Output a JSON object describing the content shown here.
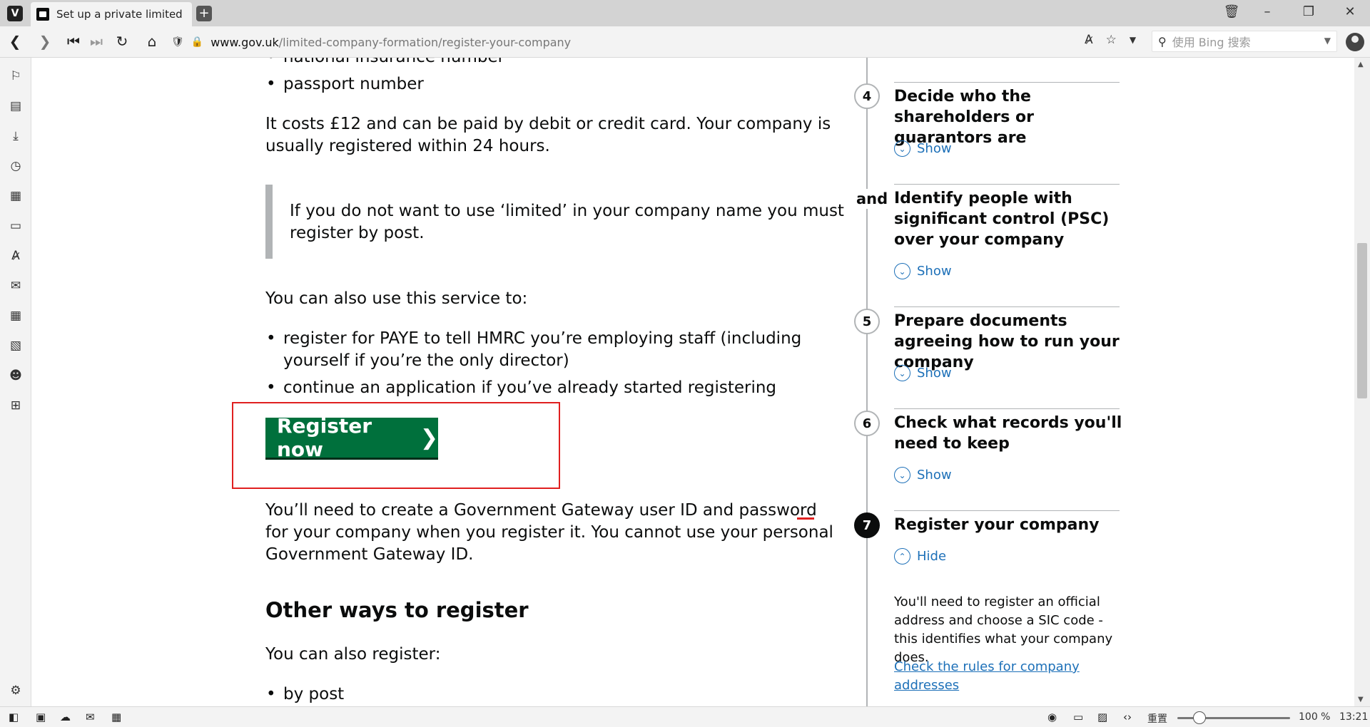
{
  "browser": {
    "logo": "V",
    "tab_title": "Set up a private limited company",
    "url_domain": "www.gov.uk",
    "url_path": "/limited-company-formation/register-your-company",
    "search_placeholder": "使用 Bing 搜索",
    "zoom_reset_label": "重置",
    "zoom_value": "100 %",
    "clock": "13:21"
  },
  "main": {
    "bullet_cut_top": "national insurance number",
    "bullet_passport": "passport number",
    "cost_text": "It costs £12 and can be paid by debit or credit card. Your company is usually registered within 24 hours.",
    "inset_text": "If you do not want to use ‘limited’ in your company name you must register by post.",
    "service_intro": "You can also use this service to:",
    "service_items": [
      "register for PAYE to tell HMRC you’re employing staff (including yourself if you’re the only director)",
      "continue an application if you’ve already started registering"
    ],
    "register_button": "Register now",
    "register_chevron": "❯",
    "gateway_text": "You’ll need to create a Government Gateway user ID and password for your company when you register it. You cannot use your personal Government Gateway ID.",
    "other_heading": "Other ways to register",
    "also_register": "You can also register:",
    "bullet_cut_bottom": "by post"
  },
  "steps": {
    "step4_num": "4",
    "step4_title": "Decide who the shareholders or guarantors are",
    "step4_toggle": "Show",
    "and_label": "and",
    "and_title": "Identify people with significant control (PSC) over your company",
    "and_toggle": "Show",
    "step5_num": "5",
    "step5_title": "Prepare documents agreeing how to run your company",
    "step5_toggle": "Show",
    "step6_num": "6",
    "step6_title": "Check what records you'll need to keep",
    "step6_toggle": "Show",
    "step7_num": "7",
    "step7_title": "Register your company",
    "step7_toggle": "Hide",
    "step7_desc": "You'll need to register an official address and choose a SIC code - this identifies what your company does.",
    "step7_link": "Check the rules for company addresses"
  },
  "colors": {
    "govuk_green": "#00703c",
    "govuk_link": "#1d70b8",
    "annotation_red": "#e02020"
  }
}
